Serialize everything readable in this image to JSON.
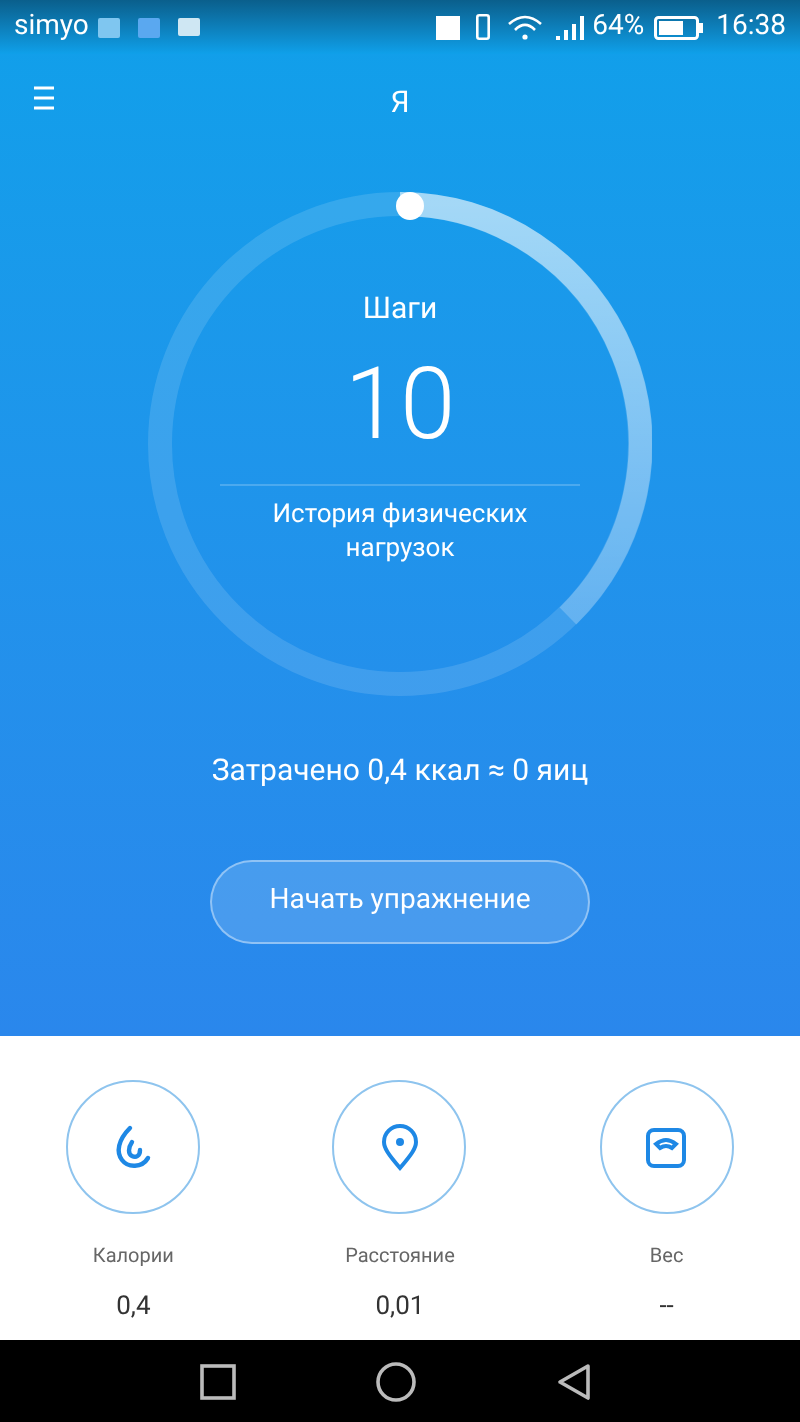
{
  "status_bar": {
    "carrier": "simyo",
    "battery": "64%",
    "time": "16:38"
  },
  "header": {
    "title": "Я"
  },
  "ring": {
    "label": "Шаги",
    "value": "10",
    "link": "История физических нагрузок"
  },
  "summary": "Затрачено 0,4 ккал ≈ 0 яиц",
  "start_button": "Начать упражнение",
  "stats": [
    {
      "kind": "calories",
      "label": "Калории",
      "value": "0,4"
    },
    {
      "kind": "distance",
      "label": "Расстояние",
      "value": "0,01"
    },
    {
      "kind": "weight",
      "label": "Вес",
      "value": "--"
    }
  ]
}
